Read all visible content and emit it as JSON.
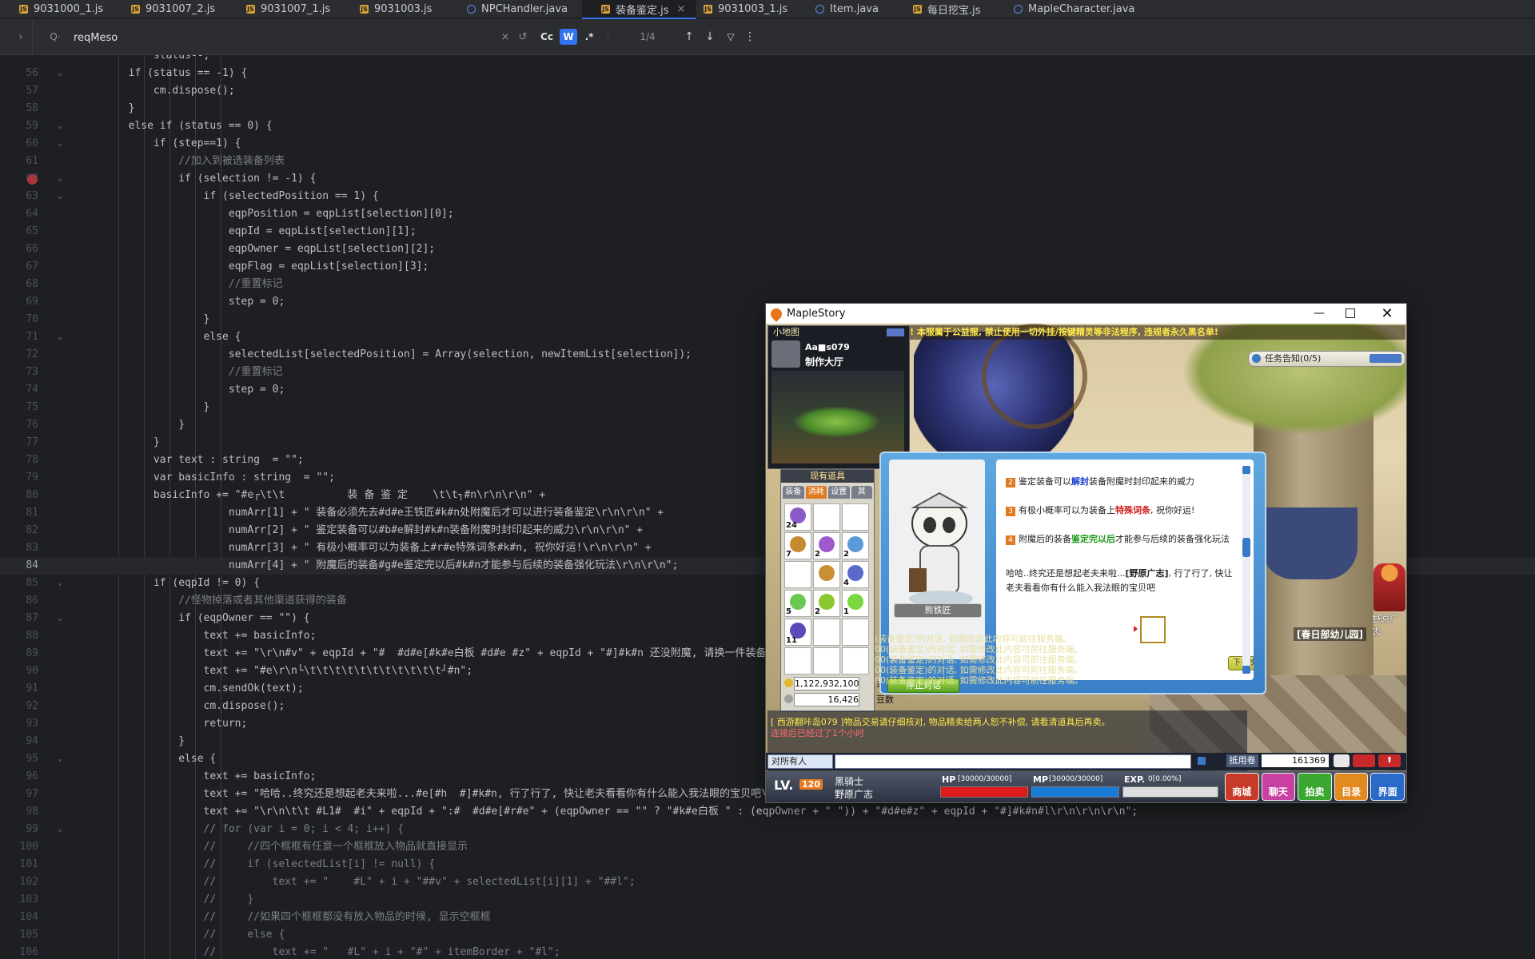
{
  "tabs": [
    {
      "label": "9031000_1.js",
      "type": "js"
    },
    {
      "label": "9031007_2.js",
      "type": "js"
    },
    {
      "label": "9031007_1.js",
      "type": "js"
    },
    {
      "label": "9031003.js",
      "type": "js"
    },
    {
      "label": "NPCHandler.java",
      "type": "java"
    },
    {
      "label": "装备鉴定.js",
      "type": "js",
      "active": true
    },
    {
      "label": "9031003_1.js",
      "type": "js"
    },
    {
      "label": "Item.java",
      "type": "java"
    },
    {
      "label": "每日挖宝.js",
      "type": "js"
    },
    {
      "label": "MapleCharacter.java",
      "type": "java"
    }
  ],
  "find": {
    "query": "reqMeso",
    "match_case": "Cc",
    "words": "W",
    "regex": ".*",
    "count": "1/4"
  },
  "code_lines": [
    {
      "n": "",
      "t": "            status--;"
    },
    {
      "n": "56",
      "t": "        if (status == -1) {"
    },
    {
      "n": "57",
      "t": "            cm.dispose();"
    },
    {
      "n": "58",
      "t": "        }"
    },
    {
      "n": "59",
      "t": "        else if (status == 0) {"
    },
    {
      "n": "60",
      "t": "            if (step==1) {"
    },
    {
      "n": "61",
      "t": "                //加入到被选装备列表"
    },
    {
      "n": "62",
      "t": "                if (selection != -1) {",
      "bp": true
    },
    {
      "n": "63",
      "t": "                    if (selectedPosition == 1) {"
    },
    {
      "n": "64",
      "t": "                        eqpPosition = eqpList[selection][0];"
    },
    {
      "n": "65",
      "t": "                        eqpId = eqpList[selection][1];"
    },
    {
      "n": "66",
      "t": "                        eqpOwner = eqpList[selection][2];"
    },
    {
      "n": "67",
      "t": "                        eqpFlag = eqpList[selection][3];"
    },
    {
      "n": "68",
      "t": "                        //重置标记"
    },
    {
      "n": "69",
      "t": "                        step = 0;"
    },
    {
      "n": "70",
      "t": "                    }"
    },
    {
      "n": "71",
      "t": "                    else {"
    },
    {
      "n": "72",
      "t": "                        selectedList[selectedPosition] = Array(selection, newItemList[selection]);"
    },
    {
      "n": "73",
      "t": "                        //重置标记"
    },
    {
      "n": "74",
      "t": "                        step = 0;"
    },
    {
      "n": "75",
      "t": "                    }"
    },
    {
      "n": "76",
      "t": "                }"
    },
    {
      "n": "77",
      "t": "            }"
    },
    {
      "n": "78",
      "t": "            var text : string  = \"\";"
    },
    {
      "n": "79",
      "t": "            var basicInfo : string  = \"\";"
    },
    {
      "n": "80",
      "t": "            basicInfo += \"#e┌\\t\\t          装 备 鉴 定    \\t\\t┐#n\\r\\n\\r\\n\" +"
    },
    {
      "n": "81",
      "t": "                        numArr[1] + \" 装备必须先去#d#e王铁匠#k#n处附魔后才可以进行装备鉴定\\r\\n\\r\\n\" +"
    },
    {
      "n": "82",
      "t": "                        numArr[2] + \" 鉴定装备可以#b#e解封#k#n装备附魔时封印起来的威力\\r\\n\\r\\n\" +"
    },
    {
      "n": "83",
      "t": "                        numArr[3] + \" 有极小概率可以为装备上#r#e特殊词条#k#n, 祝你好运!\\r\\n\\r\\n\" +"
    },
    {
      "n": "84",
      "t": "                        numArr[4] + \" 附魔后的装备#g#e鉴定完以后#k#n才能参与后续的装备强化玩法\\r\\n\\r\\n\";",
      "cur": true
    },
    {
      "n": "85",
      "t": "            if (eqpId != 0) {"
    },
    {
      "n": "86",
      "t": "                //怪物掉落或者其他渠道获得的装备"
    },
    {
      "n": "87",
      "t": "                if (eqpOwner == \"\") {"
    },
    {
      "n": "88",
      "t": "                    text += basicInfo;"
    },
    {
      "n": "89",
      "t": "                    text += \"\\r\\n#v\" + eqpId + \"#  #d#e[#k#e白板 #d#e #z\" + eqpId + \"#]#k#n 还没附魔, 请换一件装备"
    },
    {
      "n": "90",
      "t": "                    text += \"#e\\r\\n└\\t\\t\\t\\t\\t\\t\\t\\t\\t\\t\\t┘#n\";"
    },
    {
      "n": "91",
      "t": "                    cm.sendOk(text);"
    },
    {
      "n": "92",
      "t": "                    cm.dispose();"
    },
    {
      "n": "93",
      "t": "                    return;"
    },
    {
      "n": "94",
      "t": "                }"
    },
    {
      "n": "95",
      "t": "                else {"
    },
    {
      "n": "96",
      "t": "                    text += basicInfo;"
    },
    {
      "n": "97",
      "t": "                    text += \"哈哈..终究还是想起老夫来啦...#e[#h  #]#k#n, 行了行了, 快让老夫看看你有什么能入我法眼的宝贝吧\\"
    },
    {
      "n": "98",
      "t": "                    text += \"\\r\\n\\t\\t #L1#  #i\" + eqpId + \":#  #d#e[#r#e\" + (eqpOwner == \"\" ? \"#k#e白板 \" : (eqpOwner + \" \")) + \"#d#e#z\" + eqpId + \"#]#k#n#l\\r\\n\\r\\n\\r\\n\";"
    },
    {
      "n": "99",
      "t": "                    // for (var i = 0; i < 4; i++) {"
    },
    {
      "n": "100",
      "t": "                    //     //四个框框有任意一个框框放入物品就直接显示"
    },
    {
      "n": "101",
      "t": "                    //     if (selectedList[i] != null) {"
    },
    {
      "n": "102",
      "t": "                    //         text += \"    #L\" + i + \"##v\" + selectedList[i][1] + \"##l\";"
    },
    {
      "n": "103",
      "t": "                    //     }"
    },
    {
      "n": "104",
      "t": "                    //     //如果四个框框都没有放入物品的时候, 显示空框框"
    },
    {
      "n": "105",
      "t": "                    //     else {"
    },
    {
      "n": "106",
      "t": "                    //         text += \"   #L\" + i + \"#\" + itemBorder + \"#l\";"
    }
  ],
  "game": {
    "title": "MapleStory",
    "minimap_title": "小地图",
    "server_label": "Aa■s079",
    "map_name": "制作大厅",
    "banner": "! 本服属于公益服, 禁止使用一切外挂/按键精灵等非法程序, 违规者永久黑名单!",
    "quest_title": "任务告知(0/5)",
    "inventory_title": "现有道具",
    "inventory_tabs": [
      "装备",
      "消耗",
      "设置",
      "其"
    ],
    "item_counts": [
      "24",
      "",
      "",
      "7",
      "2",
      "2",
      "",
      "",
      "4",
      "5",
      "2",
      "1",
      "11"
    ],
    "meso": "1,122,932,100",
    "meso_unit": "金币",
    "points": "16,426",
    "points_unit": "豆数",
    "npc_name": "熊铁匠",
    "dialog_lines": [
      {
        "num": "2",
        "pre": "鉴定装备可以",
        "hl": "解封",
        "hlcolor": "#1d3fd0",
        "post": "装备附魔时封印起来的威力"
      },
      {
        "num": "3",
        "pre": "有极小概率可以为装备上",
        "hl": "特殊词条",
        "hlcolor": "#d01818",
        "post": ", 祝你好运!"
      },
      {
        "num": "4",
        "pre": "附魔后的装备",
        "hl": "鉴定完以后",
        "hlcolor": "#1c9a1c",
        "post": "才能参与后续的装备强化玩法"
      }
    ],
    "dialog_para_pre": "哈哈..终究还是想起老夫来啦...",
    "dialog_para_name": "[野原广志]",
    "dialog_para_post": ", 行了行了, 快让老夫看看你有什么能入我法眼的宝贝吧",
    "next_button": "下一步",
    "end_chat_button": "停止对话",
    "chat_lines": [
      "(装备鉴定)的对话, 如需修改此内容可前往服务端。",
      "00(装备鉴定)的对话, 如需修改此内容可前往服务端。",
      "00(装备鉴定)的对话, 如需修改此内容可前往服务端。",
      "00(装备鉴定)的对话, 如需修改此内容可前往服务端。",
      "00(装备鉴定)的对话, 如需修改此内容可前往服务端。"
    ],
    "notice_line": "[ 西游翻咔岛079 ]物品交易请仔细核对, 物品精卖给两人恕不补偿, 请看清道具后再卖。",
    "online_line": "连接后已经过了1个小时",
    "chat_target": "对所有人",
    "points_label": "抵用卷",
    "points_value": "161369",
    "lv_label": "LV.",
    "level": "120",
    "job": "黑骑士",
    "char_name": "野原广志",
    "map_sign": "[春日部幼儿园]",
    "npc_side_name": "野原广志",
    "hp_label": "HP",
    "hp_value": "[30000/30000]",
    "mp_label": "MP",
    "mp_value": "[30000/30000]",
    "exp_label": "EXP.",
    "exp_value": "0[0.00%]",
    "menu_buttons": [
      "商城",
      "聊天",
      "拍卖",
      "目录",
      "界面"
    ],
    "hp_fraction": 1.0,
    "mp_fraction": 1.0,
    "exp_fraction": 0.0
  }
}
